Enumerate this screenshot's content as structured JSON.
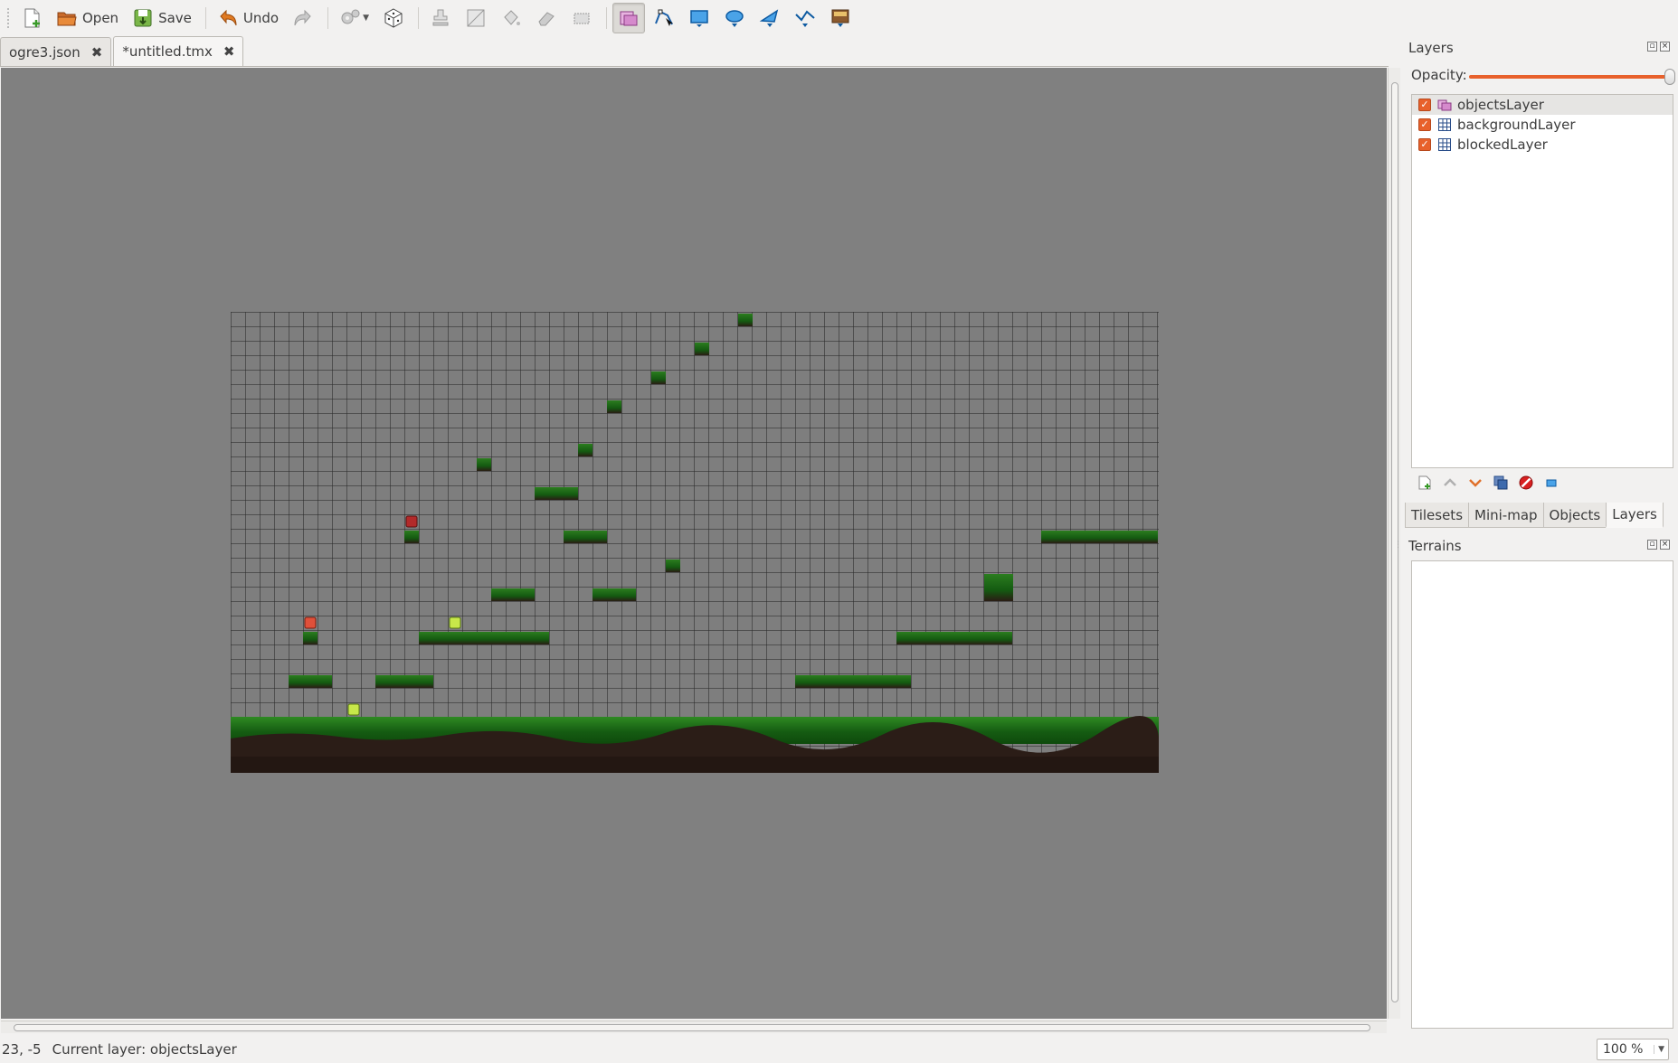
{
  "toolbar": {
    "buttons": [
      {
        "id": "new",
        "icon": "new-file-icon",
        "label": ""
      },
      {
        "id": "open",
        "icon": "open-folder-icon",
        "label": "Open"
      },
      {
        "id": "save",
        "icon": "save-icon",
        "label": "Save"
      },
      {
        "id": "undo",
        "icon": "undo-icon",
        "label": "Undo"
      },
      {
        "id": "redo",
        "icon": "redo-icon",
        "label": ""
      }
    ],
    "active_tool": "select-objects-tool"
  },
  "tabs": [
    {
      "label": "ogre3.json",
      "active": false
    },
    {
      "label": "*untitled.tmx",
      "active": true
    }
  ],
  "status": {
    "coords": "23, -5",
    "current_layer": "Current layer: objectsLayer",
    "zoom": "100 %"
  },
  "layers_panel": {
    "title": "Layers",
    "opacity_label": "Opacity:",
    "opacity": 1.0,
    "layers": [
      {
        "name": "objectsLayer",
        "type": "object",
        "visible": true,
        "selected": true
      },
      {
        "name": "backgroundLayer",
        "type": "tile",
        "visible": true,
        "selected": false
      },
      {
        "name": "blockedLayer",
        "type": "tile",
        "visible": true,
        "selected": false
      }
    ]
  },
  "dock_tabs": [
    {
      "label": "Tilesets",
      "active": false
    },
    {
      "label": "Mini-map",
      "active": false
    },
    {
      "label": "Objects",
      "active": false
    },
    {
      "label": "Layers",
      "active": true
    }
  ],
  "terrains_panel": {
    "title": "Terrains"
  },
  "colors": {
    "accent": "#e8612c",
    "canvas_bg": "#808080",
    "grass": "#1f6b1a",
    "dirt": "#2b1d17"
  }
}
